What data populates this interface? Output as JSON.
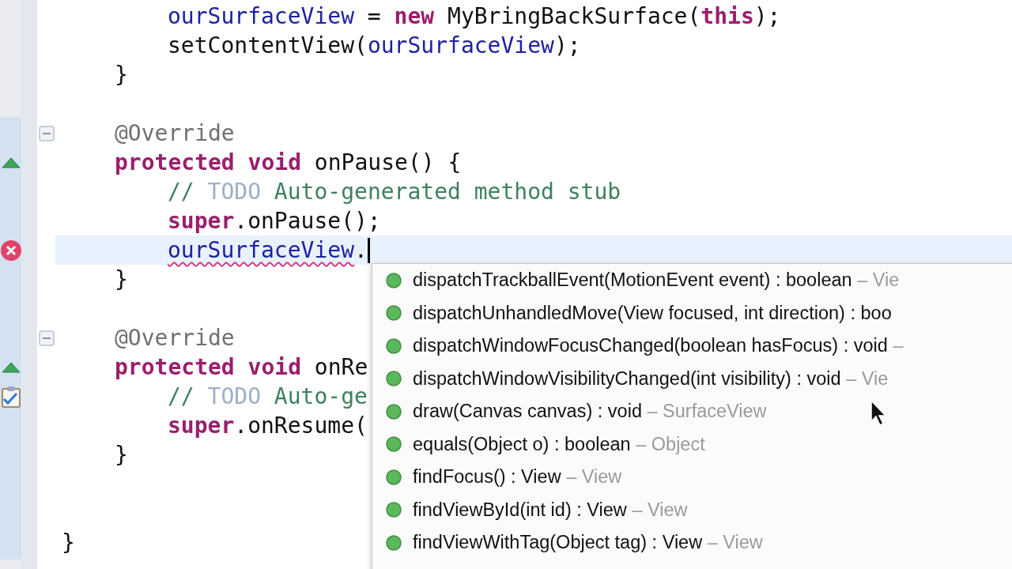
{
  "code": [
    {
      "kind": "block",
      "children": [
        {
          "kind": "block",
          "children": [
            {
              "kind": "code",
              "tokens": [
                {
                  "kind": "field",
                  "text": "ourSurfaceView"
                },
                {
                  "kind": "plain",
                  "text": " = "
                },
                {
                  "kind": "keyword",
                  "text": "new"
                },
                {
                  "kind": "plain",
                  "text": " MyBringBackSurface("
                },
                {
                  "kind": "keyword",
                  "text": "this"
                },
                {
                  "kind": "plain",
                  "text": ");"
                }
              ]
            },
            {
              "kind": "code",
              "tokens": [
                {
                  "kind": "plain",
                  "text": "setContentView("
                },
                {
                  "kind": "field",
                  "text": "ourSurfaceView"
                },
                {
                  "kind": "plain",
                  "text": ");"
                }
              ]
            }
          ]
        },
        {
          "kind": "code",
          "tokens": [
            {
              "kind": "plain",
              "text": "}"
            }
          ]
        },
        {
          "kind": "blank"
        },
        {
          "kind": "code",
          "expanded": true,
          "tokens": [
            {
              "kind": "annotation",
              "text": "@Override"
            }
          ]
        },
        {
          "kind": "code",
          "marker": {
            "kind": "override"
          },
          "tokens": [
            {
              "kind": "keyword",
              "text": "protected void"
            },
            {
              "kind": "plain",
              "text": " onPause() {"
            }
          ]
        },
        {
          "kind": "block",
          "children": [
            {
              "kind": "code",
              "tokens": [
                {
                  "kind": "comment",
                  "text": "// "
                },
                {
                  "kind": "todo",
                  "text": "TODO"
                },
                {
                  "kind": "comment",
                  "text": " Auto-generated method stub"
                }
              ]
            },
            {
              "kind": "code",
              "tokens": [
                {
                  "kind": "keyword",
                  "text": "super"
                },
                {
                  "kind": "plain",
                  "text": ".onPause();"
                }
              ]
            },
            {
              "kind": "code",
              "marker": {
                "kind": "error"
              },
              "current": true,
              "caret": true,
              "tokens": [
                {
                  "kind": "error",
                  "text": "ourSurfaceView"
                },
                {
                  "kind": "plain",
                  "text": "."
                }
              ]
            }
          ]
        },
        {
          "kind": "code",
          "tokens": [
            {
              "kind": "plain",
              "text": "}"
            }
          ]
        },
        {
          "kind": "blank"
        },
        {
          "kind": "code",
          "expanded": true,
          "tokens": [
            {
              "kind": "annotation",
              "text": "@Override"
            }
          ]
        },
        {
          "kind": "code",
          "marker": {
            "kind": "override"
          },
          "tokens": [
            {
              "kind": "keyword",
              "text": "protected void"
            },
            {
              "kind": "plain",
              "text": " onRe"
            }
          ]
        },
        {
          "kind": "block",
          "children": [
            {
              "kind": "code",
              "marker": {
                "kind": "task"
              },
              "tokens": [
                {
                  "kind": "comment",
                  "text": "// "
                },
                {
                  "kind": "todo",
                  "text": "TODO"
                },
                {
                  "kind": "comment",
                  "text": " Auto-ge"
                }
              ]
            },
            {
              "kind": "code",
              "tokens": [
                {
                  "kind": "keyword",
                  "text": "super"
                },
                {
                  "kind": "plain",
                  "text": ".onResume("
                }
              ]
            }
          ]
        },
        {
          "kind": "code",
          "tokens": [
            {
              "kind": "plain",
              "text": "}"
            }
          ]
        },
        {
          "kind": "blank"
        },
        {
          "kind": "blank"
        }
      ]
    },
    {
      "kind": "code",
      "tokens": [
        {
          "kind": "plain",
          "text": "}"
        }
      ]
    }
  ],
  "completions": [
    {
      "signature": "dispatchTrackballEvent(MotionEvent event) : boolean",
      "owner": "– Vie"
    },
    {
      "signature": "dispatchUnhandledMove(View focused, int direction) : boo"
    },
    {
      "signature": "dispatchWindowFocusChanged(boolean hasFocus) : void",
      "owner": "–"
    },
    {
      "signature": "dispatchWindowVisibilityChanged(int visibility) : void",
      "owner": "– Vie"
    },
    {
      "signature": "draw(Canvas canvas) : void",
      "owner": "– SurfaceView"
    },
    {
      "signature": "equals(Object o) : boolean",
      "owner": "– Object"
    },
    {
      "signature": "findFocus() : View",
      "owner": "– View"
    },
    {
      "signature": "findViewById(int id) : View",
      "owner": "– View"
    },
    {
      "signature": "findViewWithTag(Object tag) : View",
      "owner": "– View"
    }
  ]
}
